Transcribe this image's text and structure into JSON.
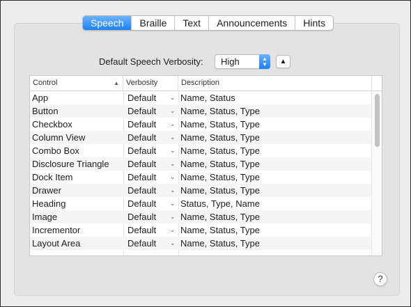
{
  "tabs": [
    {
      "label": "Speech",
      "active": true
    },
    {
      "label": "Braille",
      "active": false
    },
    {
      "label": "Text",
      "active": false
    },
    {
      "label": "Announcements",
      "active": false
    },
    {
      "label": "Hints",
      "active": false
    }
  ],
  "verbosity": {
    "label": "Default Speech Verbosity:",
    "selected": "High",
    "collapse_glyph": "▲"
  },
  "table": {
    "headers": {
      "control": "Control",
      "verbosity": "Verbosity",
      "description": "Description"
    },
    "sort_indicator": "▲",
    "rows": [
      {
        "control": "App",
        "verbosity": "Default",
        "description": "Name, Status"
      },
      {
        "control": "Button",
        "verbosity": "Default",
        "description": "Name, Status, Type"
      },
      {
        "control": "Checkbox",
        "verbosity": "Default",
        "description": "Name, Status, Type"
      },
      {
        "control": "Column View",
        "verbosity": "Default",
        "description": "Name, Status, Type"
      },
      {
        "control": "Combo Box",
        "verbosity": "Default",
        "description": "Name, Status, Type"
      },
      {
        "control": "Disclosure Triangle",
        "verbosity": "Default",
        "description": "Name, Status, Type"
      },
      {
        "control": "Dock Item",
        "verbosity": "Default",
        "description": "Name, Status, Type"
      },
      {
        "control": "Drawer",
        "verbosity": "Default",
        "description": "Name, Status, Type"
      },
      {
        "control": "Heading",
        "verbosity": "Default",
        "description": "Status, Type, Name"
      },
      {
        "control": "Image",
        "verbosity": "Default",
        "description": "Name, Status, Type"
      },
      {
        "control": "Incrementor",
        "verbosity": "Default",
        "description": "Name, Status, Type"
      },
      {
        "control": "Layout Area",
        "verbosity": "Default",
        "description": "Name, Status, Type"
      }
    ]
  },
  "help": {
    "label": "?"
  },
  "colors": {
    "accent": "#1a82fb",
    "panel": "#e3e3e3",
    "window": "#ececec"
  }
}
